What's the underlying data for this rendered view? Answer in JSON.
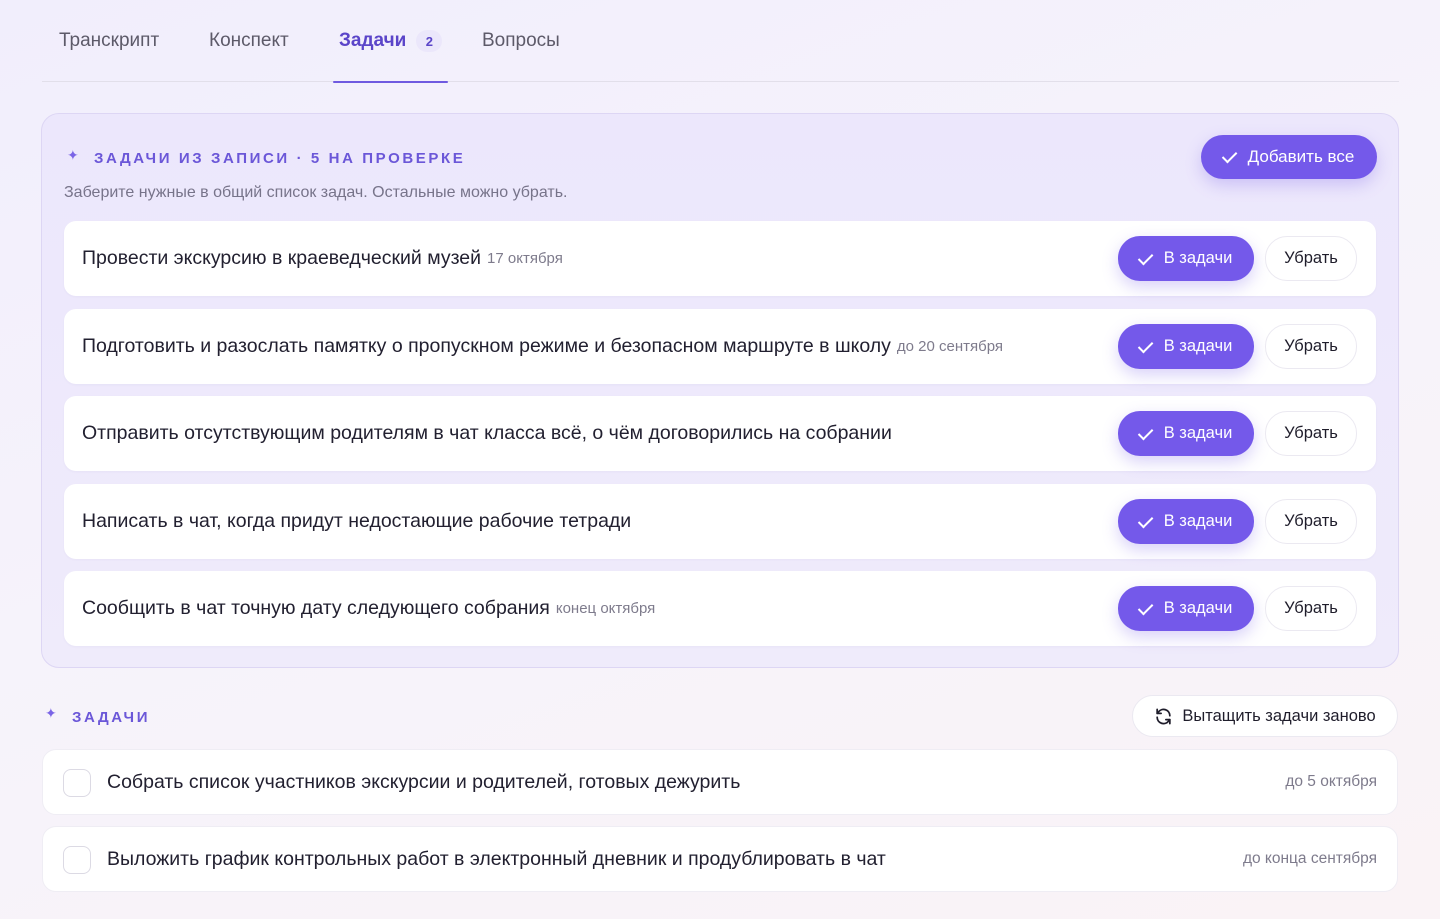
{
  "tabs": [
    {
      "label": "Транскрипт"
    },
    {
      "label": "Конспект"
    },
    {
      "label": "Задачи",
      "badge": "2"
    },
    {
      "label": "Вопросы"
    }
  ],
  "active_tab": "Задачи",
  "review": {
    "title": "ЗАДАЧИ ИЗ ЗАПИСИ · 5 НА ПРОВЕРКЕ",
    "subtitle": "Заберите нужные в общий список задач. Остальные можно убрать.",
    "add_all_label": "Добавить все",
    "to_tasks_label": "В задачи",
    "remove_label": "Убрать",
    "items": [
      {
        "text": "Провести экскурсию в краеведческий музей",
        "date": "17 октября"
      },
      {
        "text": "Подготовить и разослать памятку о пропускном режиме и безопасном маршруте в школу",
        "date": "до 20 сентября"
      },
      {
        "text": "Отправить отсутствующим родителям в чат класса всё, о чём договорились на собрании",
        "date": ""
      },
      {
        "text": "Написать в чат, когда придут недостающие рабочие тетради",
        "date": ""
      },
      {
        "text": "Сообщить в чат точную дату следующего собрания",
        "date": "конец октября"
      }
    ]
  },
  "tasks": {
    "title": "ЗАДАЧИ",
    "refresh_label": "Вытащить задачи заново",
    "items": [
      {
        "text": "Собрать список участников экскурсии и родителей, готовых дежурить",
        "date": "до 5 октября",
        "checked": false
      },
      {
        "text": "Выложить график контрольных работ в электронный дневник и продублировать в чат",
        "date": "до конца сентября",
        "checked": false
      }
    ]
  },
  "icons": {
    "section": "sparkle-icon",
    "confirm": "check-icon",
    "refresh": "refresh-icon"
  },
  "colors": {
    "accent": "#7459ea",
    "accent_text": "#5b45c9",
    "muted_text": "#7e7b8c"
  }
}
